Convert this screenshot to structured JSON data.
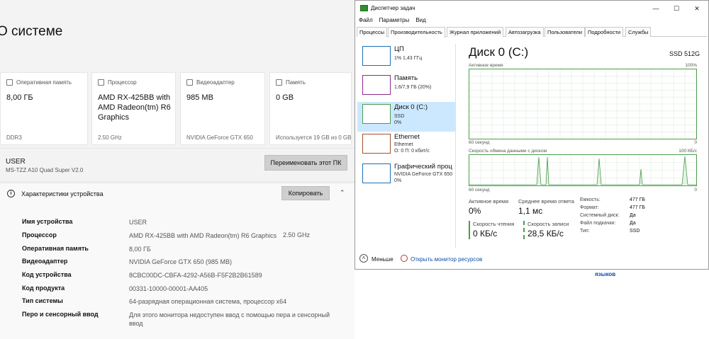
{
  "settings": {
    "page_title": "О системе",
    "cards": [
      {
        "title": "Оперативная память",
        "value": "8,00 ГБ",
        "footer": "DDR3"
      },
      {
        "title": "Процессор",
        "value": "AMD RX-425BB with AMD Radeon(tm) R6 Graphics",
        "footer": "2.50 GHz"
      },
      {
        "title": "Видеоадаптер",
        "value": "985 MB",
        "footer": "NVIDIA GeForce GTX 650"
      },
      {
        "title": "Память",
        "value": "0 GB",
        "footer": "Используется 19 GB из 0 GB"
      }
    ],
    "device": {
      "name": "USER",
      "model": "MS-TZZ A10 Quad Super V2.0",
      "rename_label": "Переименовать этот ПК"
    },
    "specs": {
      "title": "Характеристики устройства",
      "copy_label": "Копировать",
      "rows": [
        {
          "label": "Имя устройства",
          "value": "USER",
          "extra": ""
        },
        {
          "label": "Процессор",
          "value": "AMD RX-425BB with AMD Radeon(tm) R6 Graphics",
          "extra": "2.50 GHz"
        },
        {
          "label": "Оперативная память",
          "value": "8,00 ГБ",
          "extra": ""
        },
        {
          "label": "Видеоадаптер",
          "value": "NVIDIA GeForce GTX 650 (985 MB)",
          "extra": ""
        },
        {
          "label": "Код устройства",
          "value": "8CBC00DC-CBFA-4292-A56B-F5F2B2B61589",
          "extra": ""
        },
        {
          "label": "Код продукта",
          "value": "00331-10000-00001-AA405",
          "extra": ""
        },
        {
          "label": "Тип системы",
          "value": "64-разрядная операционная система, процессор x64",
          "extra": ""
        },
        {
          "label": "Перо и сенсорный ввод",
          "value": "Для этого монитора недоступен ввод с помощью пера и сенсорный ввод",
          "extra": ""
        }
      ]
    },
    "languages_link": "языков"
  },
  "taskmgr": {
    "title": "Диспетчер задач",
    "window_controls": {
      "minimize": "—",
      "maximize": "☐",
      "close": "✕"
    },
    "menu": [
      "Файл",
      "Параметры",
      "Вид"
    ],
    "tabs": [
      "Процессы",
      "Производительность",
      "Журнал приложений",
      "Автозагрузка",
      "Пользователи",
      "Подробности",
      "Службы"
    ],
    "active_tab": "Производительность",
    "resources": [
      {
        "name": "ЦП",
        "sub1": "1% 1,43 ГГц",
        "sub2": "",
        "color": "#1c6fb5"
      },
      {
        "name": "Память",
        "sub1": "1,6/7,9 ГБ (20%)",
        "sub2": "",
        "color": "#8b2a8b"
      },
      {
        "name": "Диск 0 (C:)",
        "sub1": "SSD",
        "sub2": "0%",
        "color": "#4c9c4c"
      },
      {
        "name": "Ethernet",
        "sub1": "Ethernet",
        "sub2": "О: 0 П: 0 кбит/с",
        "color": "#a0522d"
      },
      {
        "name": "Графический проц",
        "sub1": "NVIDIA GeForce GTX 650",
        "sub2": "0%",
        "color": "#1c6fb5"
      }
    ],
    "disk": {
      "title": "Диск 0 (C:)",
      "model": "SSD 512G",
      "graph1": {
        "label": "Активное время",
        "max": "100%",
        "time": "60 секунд",
        "min": "0"
      },
      "graph2": {
        "label": "Скорость обмена данными с диском",
        "max": "100 КБ/с",
        "time": "60 секунд",
        "min": "0"
      },
      "stats": {
        "active_time_label": "Активное время",
        "active_time": "0%",
        "avg_response_label": "Среднее время ответа",
        "avg_response": "1,1 мс",
        "read_label": "Скорость чтения",
        "read": "0 КБ/с",
        "write_label": "Скорость записи",
        "write": "28,5 КБ/с"
      },
      "props": [
        {
          "label": "Емкость:",
          "value": "477 ГБ"
        },
        {
          "label": "Формат:",
          "value": "477 ГБ"
        },
        {
          "label": "Системный диск:",
          "value": "Да"
        },
        {
          "label": "Файл подкачки:",
          "value": "Да"
        },
        {
          "label": "Тип:",
          "value": "SSD"
        }
      ]
    },
    "footer": {
      "less": "Меньше",
      "monitor": "Открыть монитор ресурсов"
    }
  }
}
